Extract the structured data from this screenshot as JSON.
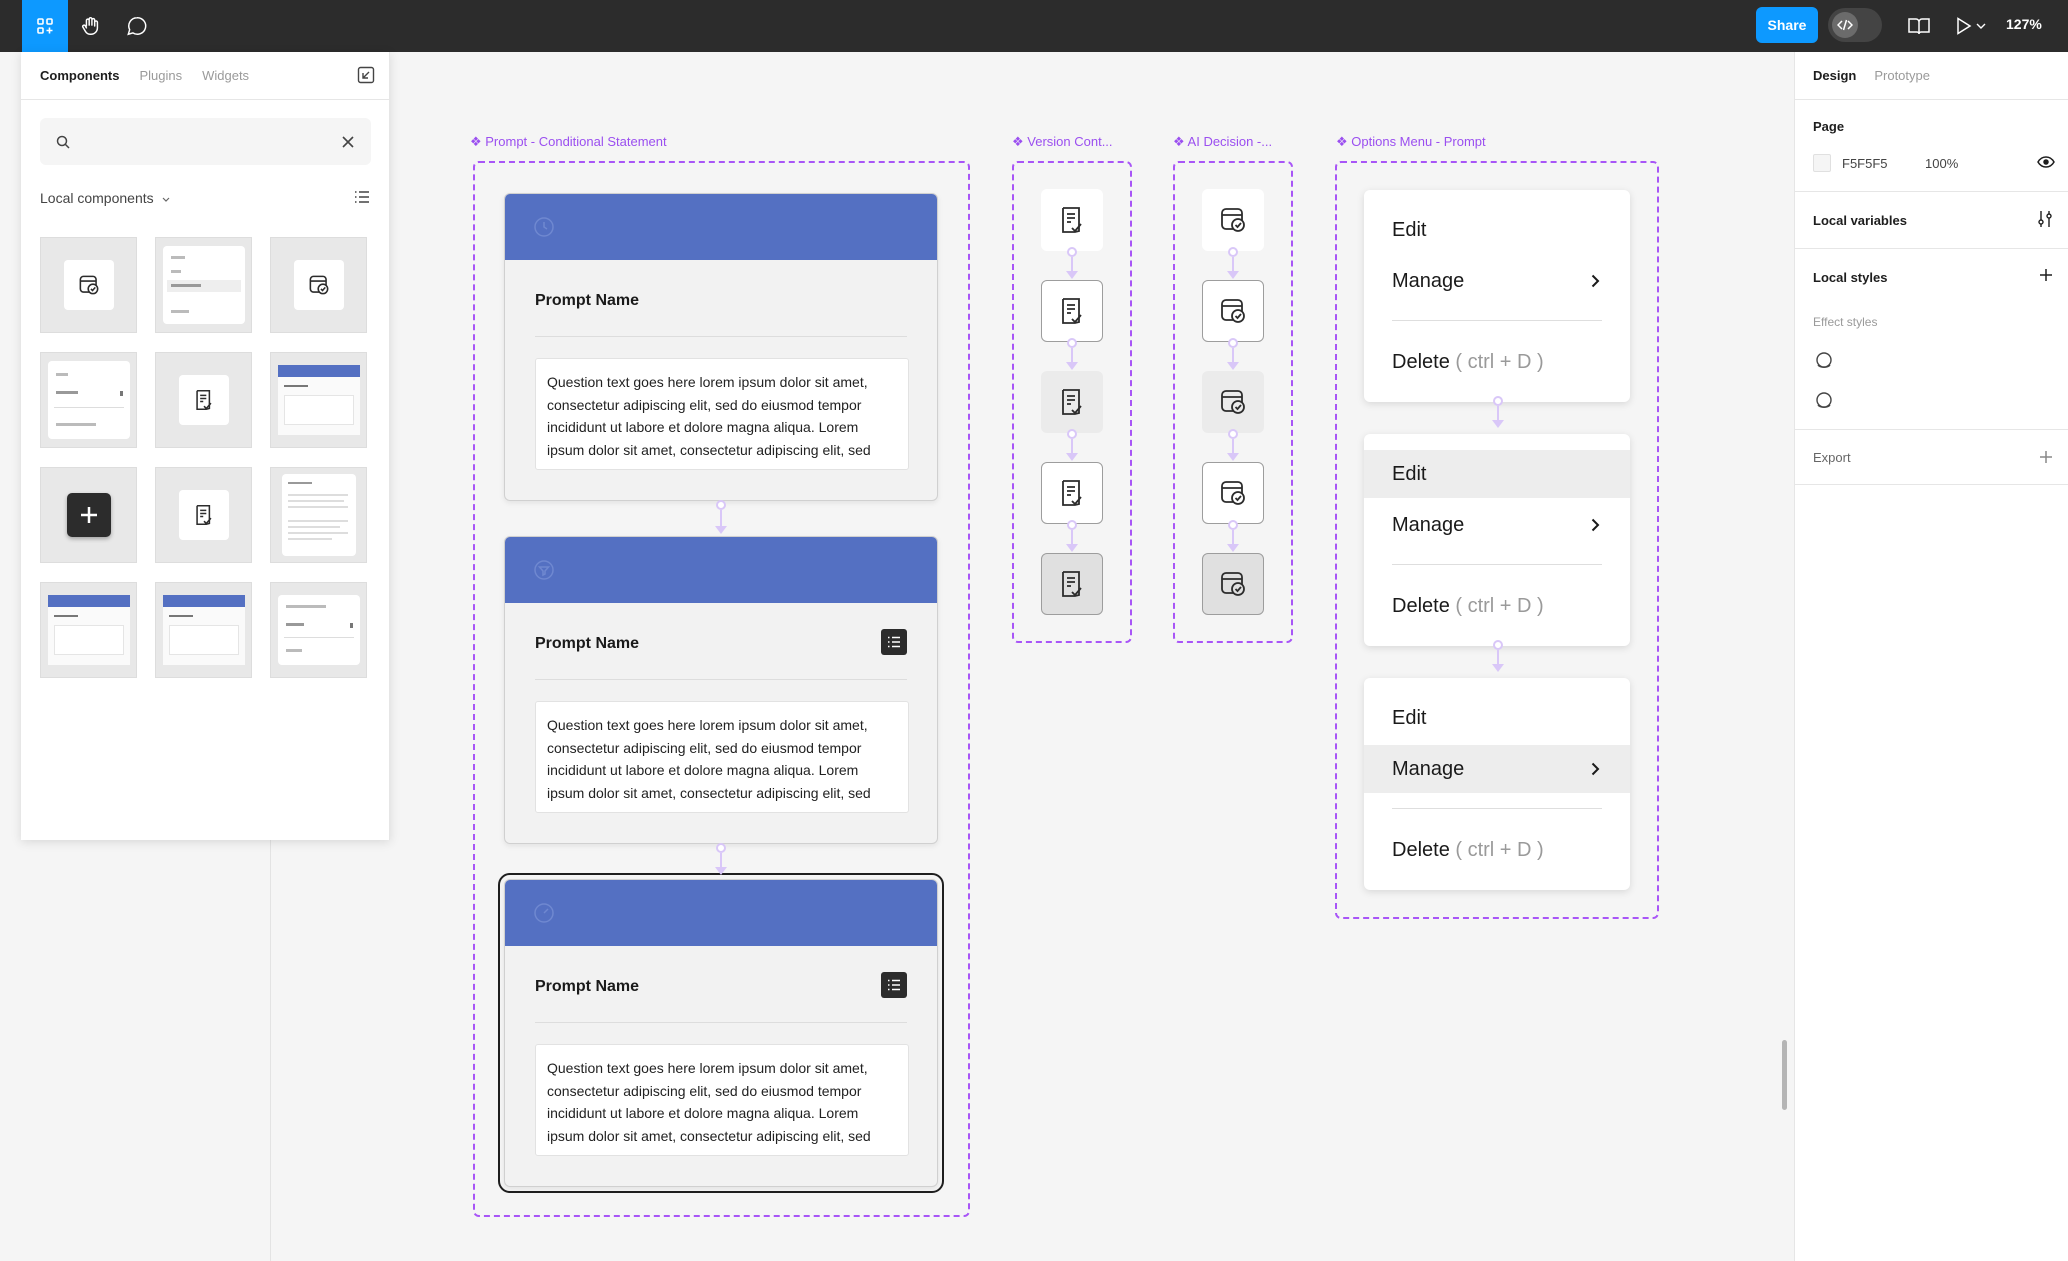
{
  "toolbar": {
    "share_label": "Share",
    "zoom": "127%"
  },
  "assets_panel": {
    "tabs": [
      "Components",
      "Plugins",
      "Widgets"
    ],
    "active_tab": "Components",
    "search_value": "",
    "local_components_label": "Local components",
    "thumbnails": [
      {
        "kind": "calendar-check"
      },
      {
        "kind": "mini-menu"
      },
      {
        "kind": "calendar-check"
      },
      {
        "kind": "mini-options-menu"
      },
      {
        "kind": "document-check"
      },
      {
        "kind": "mini-prompt-card"
      },
      {
        "kind": "plus-button"
      },
      {
        "kind": "document-check"
      },
      {
        "kind": "mini-text-doc"
      },
      {
        "kind": "mini-prompt-card"
      },
      {
        "kind": "mini-prompt-card"
      },
      {
        "kind": "mini-version-menu"
      }
    ]
  },
  "sections": [
    {
      "label": "❖ Prompt - Conditional Statement"
    },
    {
      "label": "❖ Version Cont..."
    },
    {
      "label": "❖ AI Decision -..."
    },
    {
      "label": "❖ Options Menu - Prompt"
    }
  ],
  "prompt_cards": [
    {
      "name": "Prompt Name",
      "question": "Question text goes here lorem ipsum dolor sit amet, consectetur adipiscing elit, sed do eiusmod tempor incididunt ut labore et dolore magna aliqua. Lorem ipsum dolor sit amet, consectetur adipiscing elit, sed",
      "has_list_button": false,
      "selected": false
    },
    {
      "name": "Prompt Name",
      "question": "Question text goes here lorem ipsum dolor sit amet, consectetur adipiscing elit, sed do eiusmod tempor incididunt ut labore et dolore magna aliqua. Lorem ipsum dolor sit amet, consectetur adipiscing elit, sed",
      "has_list_button": true,
      "selected": false
    },
    {
      "name": "Prompt Name",
      "question": "Question text goes here lorem ipsum dolor sit amet, consectetur adipiscing elit, sed do eiusmod tempor incididunt ut labore et dolore magna aliqua. Lorem ipsum dolor sit amet, consectetur adipiscing elit, sed",
      "has_list_button": true,
      "selected": true
    }
  ],
  "option_menus": [
    {
      "edit": "Edit",
      "manage": "Manage",
      "delete": "Delete",
      "shortcut": "( ctrl + D )",
      "highlight": "none"
    },
    {
      "edit": "Edit",
      "manage": "Manage",
      "delete": "Delete",
      "shortcut": "( ctrl + D )",
      "highlight": "edit"
    },
    {
      "edit": "Edit",
      "manage": "Manage",
      "delete": "Delete",
      "shortcut": "( ctrl + D )",
      "highlight": "manage"
    }
  ],
  "right_panel": {
    "tabs": [
      "Design",
      "Prototype"
    ],
    "active_tab": "Design",
    "page_label": "Page",
    "page_color_hex": "F5F5F5",
    "page_opacity": "100%",
    "local_variables": "Local variables",
    "local_styles": "Local styles",
    "effect_styles": "Effect styles",
    "export": "Export"
  },
  "colors": {
    "accent": "#0d99ff",
    "section_border": "#a855f7",
    "card_header": "#5470c2",
    "toolbar_bg": "#2c2c2c",
    "canvas_bg": "#f5f5f5"
  }
}
